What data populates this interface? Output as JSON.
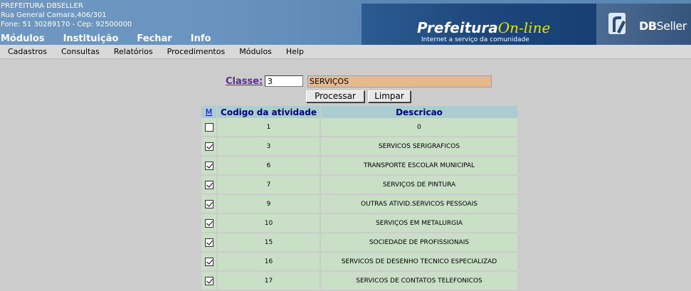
{
  "header": {
    "org_name": "PREFEITURA DBSELLER",
    "org_address": "Rua General Camara,406/301",
    "org_phone": "Fone: 51 30289170  -  Cep: 92500000",
    "top_nav": [
      "Módulos",
      "Instituição",
      "Fechar",
      "Info"
    ],
    "logo_title_part1": "Prefeitura",
    "logo_title_part2": "On-line",
    "logo_subtitle": "Internet a serviço da comunidade",
    "brand_part1": "DB",
    "brand_part2": "Seller",
    "colors": {
      "header_bg": "#6a93bf",
      "banner_bg": "#1c467c",
      "online_accent": "#e6e600"
    }
  },
  "menubar": [
    "Cadastros",
    "Consultas",
    "Relatórios",
    "Procedimentos",
    "Módulos",
    "Help"
  ],
  "form": {
    "classe_label": "Classe:",
    "classe_code": "3",
    "classe_description": "SERVIÇOS",
    "process_label": "Processar",
    "clear_label": "Limpar"
  },
  "table": {
    "headers": {
      "m": "M",
      "codigo": "Codigo da atividade",
      "descricao": "Descricao"
    },
    "rows": [
      {
        "checked": false,
        "codigo": "1",
        "descricao": "0"
      },
      {
        "checked": true,
        "codigo": "3",
        "descricao": "SERVICOS SERIGRAFICOS"
      },
      {
        "checked": true,
        "codigo": "6",
        "descricao": "TRANSPORTE ESCOLAR MUNICIPAL"
      },
      {
        "checked": true,
        "codigo": "7",
        "descricao": "SERVIÇOS DE PINTURA"
      },
      {
        "checked": true,
        "codigo": "9",
        "descricao": "OUTRAS ATIVID.SERVICOS PESSOAIS"
      },
      {
        "checked": true,
        "codigo": "10",
        "descricao": "SERVIÇOS EM METALURGIA"
      },
      {
        "checked": true,
        "codigo": "15",
        "descricao": "SOCIEDADE DE PROFISSIONAIS"
      },
      {
        "checked": true,
        "codigo": "16",
        "descricao": "SERVICOS DE DESENHO TECNICO ESPECIALIZAD"
      },
      {
        "checked": true,
        "codigo": "17",
        "descricao": "SERVICOS DE CONTATOS TELEFONICOS"
      }
    ]
  }
}
